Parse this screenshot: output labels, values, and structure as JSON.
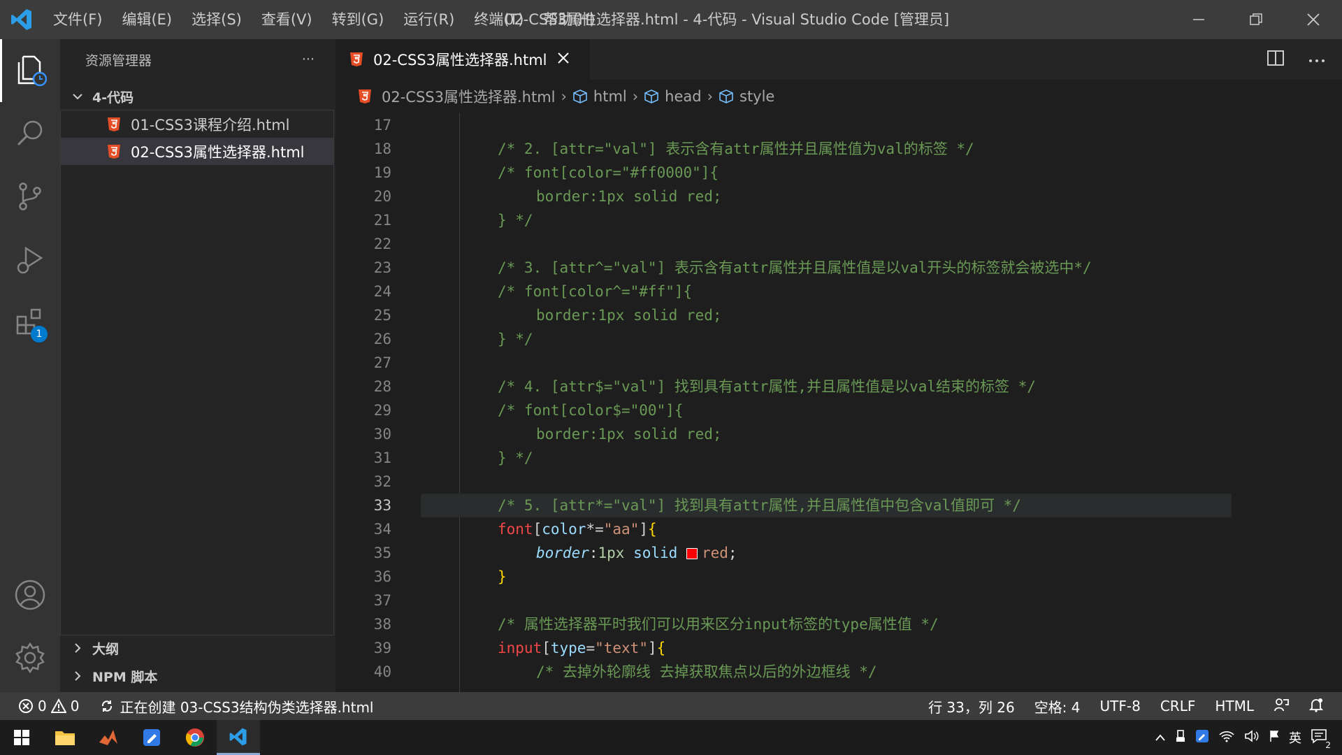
{
  "titlebar": {
    "menu": [
      "文件(F)",
      "编辑(E)",
      "选择(S)",
      "查看(V)",
      "转到(G)",
      "运行(R)",
      "终端(T)",
      "帮助(H)"
    ],
    "title": "02-CSS3属性选择器.html - 4-代码 - Visual Studio Code [管理员]"
  },
  "activitybar": {
    "items": [
      "explorer-icon",
      "search-icon",
      "source-control-icon",
      "run-debug-icon",
      "extensions-icon",
      "account-icon",
      "settings-gear-icon"
    ],
    "extensions_badge": "1"
  },
  "sidebar": {
    "header": "资源管理器",
    "more": "···",
    "folder": "4-代码",
    "files": [
      "01-CSS3课程介绍.html",
      "02-CSS3属性选择器.html"
    ],
    "outline": "大纲",
    "npm": "NPM 脚本"
  },
  "editor": {
    "tab_label": "02-CSS3属性选择器.html",
    "breadcrumb": [
      "02-CSS3属性选择器.html",
      "html",
      "head",
      "style"
    ],
    "line_numbers": [
      "17",
      "18",
      "19",
      "20",
      "21",
      "22",
      "23",
      "24",
      "25",
      "26",
      "27",
      "28",
      "29",
      "30",
      "31",
      "32",
      "33",
      "34",
      "35",
      "36",
      "37",
      "38",
      "39",
      "40"
    ],
    "current_line": "33",
    "lines": {
      "l18": "/* 2. [attr=\"val\"] 表示含有attr属性并且属性值为val的标签 */",
      "l19": "/* font[color=\"#ff0000\"]{",
      "l20": "border:1px solid red;",
      "l21": "} */",
      "l23": "/* 3. [attr^=\"val\"] 表示含有attr属性并且属性值是以val开头的标签就会被选中*/",
      "l24": "/* font[color^=\"#ff\"]{",
      "l25": "border:1px solid red;",
      "l26": "} */",
      "l28": "/* 4. [attr$=\"val\"] 找到具有attr属性,并且属性值是以val结束的标签 */",
      "l29": "/* font[color$=\"00\"]{",
      "l30": "border:1px solid red;",
      "l31": "} */",
      "l33": "/* 5. [attr*=\"val\"] 找到具有attr属性,并且属性值中包含val值即可 */",
      "l34_tag": "font",
      "l34_attr": "color",
      "l34_op": "*=",
      "l34_str": "\"aa\"",
      "l35_prop": "border",
      "l35_num": "1px",
      "l35_kw": "solid",
      "l35_val": "red",
      "l36": "}",
      "l38": "/* 属性选择器平时我们可以用来区分input标签的type属性值 */",
      "l39_tag": "input",
      "l39_attr": "type",
      "l39_str": "\"text\"",
      "l40": "/* 去掉外轮廓线 去掉获取焦点以后的外边框线 */"
    }
  },
  "statusbar": {
    "errors": "0",
    "warnings": "0",
    "task": "正在创建 03-CSS3结构伪类选择器.html",
    "position": "行 33，列 26",
    "spaces": "空格: 4",
    "encoding": "UTF-8",
    "eol": "CRLF",
    "language": "HTML"
  },
  "taskbar": {
    "apps": [
      "windows-start-icon",
      "file-explorer-icon",
      "matlab-icon",
      "notes-app-icon",
      "chrome-icon",
      "vscode-icon"
    ],
    "ime": "英",
    "notification_count": "2"
  },
  "colors": {
    "accent": "#007acc",
    "comment": "#6a9955",
    "tag": "#f44747",
    "string": "#ce9178"
  }
}
